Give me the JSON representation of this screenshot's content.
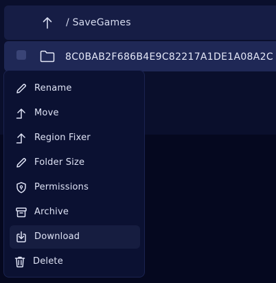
{
  "breadcrumb": {
    "path": "/ SaveGames",
    "up_icon": "arrow-up-icon"
  },
  "row": {
    "folder_name": "8C0BAB2F686B4E9C82217A1DE1A08A2C",
    "folder_icon": "folder-icon",
    "selected": false
  },
  "context_menu": {
    "items": [
      {
        "label": "Rename",
        "icon": "pencil-icon"
      },
      {
        "label": "Move",
        "icon": "arrow-up-icon"
      },
      {
        "label": "Region Fixer",
        "icon": "arrow-up-icon"
      },
      {
        "label": "Folder Size",
        "icon": "pencil-icon"
      },
      {
        "label": "Permissions",
        "icon": "shield-icon"
      },
      {
        "label": "Archive",
        "icon": "archive-icon"
      },
      {
        "label": "Download",
        "icon": "download-icon",
        "highlighted": true
      },
      {
        "label": "Delete",
        "icon": "trash-icon"
      }
    ]
  },
  "colors": {
    "background": "#05081f",
    "panel": "#0a0f2c",
    "row_selected": "#1f2856",
    "menu": "#0b1132",
    "menu_highlight": "#161d40",
    "text": "#dfe3f5"
  }
}
